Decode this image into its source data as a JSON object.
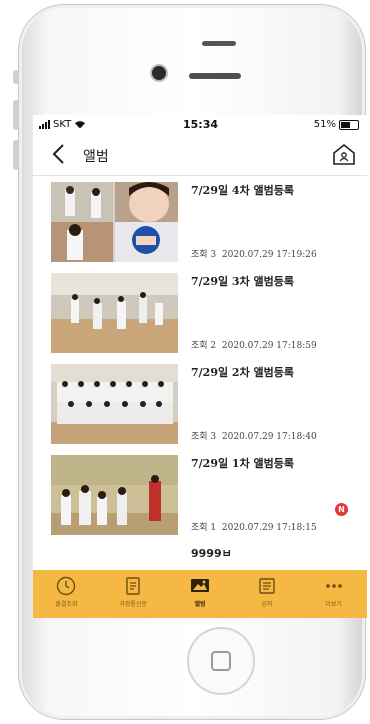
{
  "status": {
    "carrier": "SKT",
    "time": "15:34",
    "battery": "51%"
  },
  "header": {
    "title": "앨범"
  },
  "albums": [
    {
      "title": "7/29일 4차 앨범등록",
      "views": "조회 3",
      "datetime": "2020.07.29 17:19:26",
      "new": false
    },
    {
      "title": "7/29일 3차 앨범등록",
      "views": "조회 2",
      "datetime": "2020.07.29 17:18:59",
      "new": false
    },
    {
      "title": "7/29일 2차 앨범등록",
      "views": "조회 3",
      "datetime": "2020.07.29 17:18:40",
      "new": false
    },
    {
      "title": "7/29일 1차 앨범등록",
      "views": "조회 1",
      "datetime": "2020.07.29 17:18:15",
      "new": true,
      "badge": "N"
    }
  ],
  "partial_item": {
    "title": "9999ㅂ"
  },
  "tabs": [
    {
      "label": "출결조회",
      "icon": "clock-icon",
      "active": false
    },
    {
      "label": "가정통신문",
      "icon": "document-icon",
      "active": false
    },
    {
      "label": "앨범",
      "icon": "photo-icon",
      "active": true
    },
    {
      "label": "공지",
      "icon": "notice-icon",
      "active": false
    },
    {
      "label": "더보기",
      "icon": "more-icon",
      "active": false
    }
  ],
  "colors": {
    "tabbar": "#f4b843",
    "badge": "#e53935"
  }
}
